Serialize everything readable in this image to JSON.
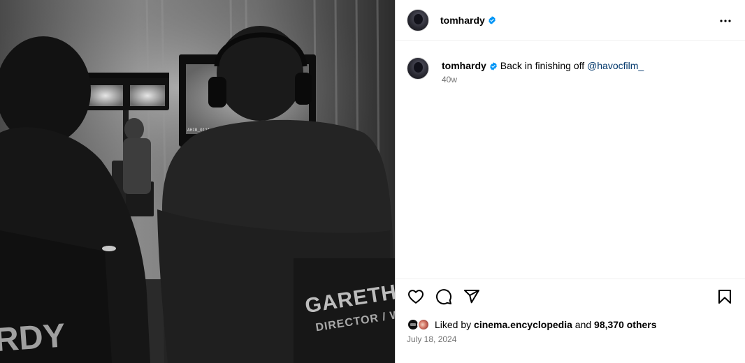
{
  "post": {
    "author": {
      "username": "tomhardy",
      "verified": true
    },
    "menu_icon": "more-horizontal-icon",
    "caption": {
      "username": "tomhardy",
      "text": "Back in finishing off",
      "mention": "@havocfilm_",
      "time_ago": "40w"
    },
    "image": {
      "chair_text_left": "RDY",
      "chair_text_name": "GARETH EV",
      "chair_text_role": "DIRECTOR / WR",
      "monitor_label": "AHIB_0111"
    },
    "actions": {
      "like_icon": "heart-icon",
      "comment_icon": "comment-icon",
      "share_icon": "send-icon",
      "save_icon": "bookmark-icon"
    },
    "likes": {
      "prefix": "Liked by",
      "first_liker": "cinema.encyclopedia",
      "connector": "and",
      "others": "98,370 others"
    },
    "date": "July 18, 2024"
  },
  "colors": {
    "verified_badge": "#0095f6",
    "mention_link": "#00376b",
    "secondary_text": "#737373",
    "divider": "#efefef"
  }
}
